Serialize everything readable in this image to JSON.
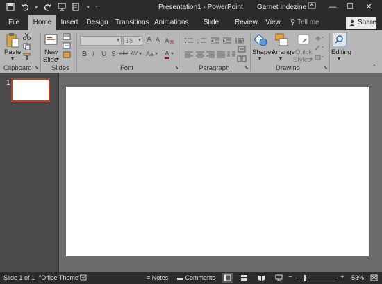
{
  "titlebar": {
    "title": "Presentation1 - PowerPoint",
    "user": "Garnet Indezine",
    "minimize": "—",
    "maximize": "☐",
    "close": "✕"
  },
  "tabs": [
    "File",
    "Home",
    "Insert",
    "Design",
    "Transitions",
    "Animations",
    "Slide Show",
    "Review",
    "View"
  ],
  "tellme": "Tell me",
  "share": "Share",
  "ribbon": {
    "clipboard": {
      "paste": "Paste",
      "label": "Clipboard"
    },
    "slides": {
      "new_slide_1": "New",
      "new_slide_2": "Slide",
      "label": "Slides"
    },
    "font": {
      "font_name": "",
      "font_size": "18",
      "grow": "A",
      "shrink": "A",
      "bold": "B",
      "italic": "I",
      "underline": "U",
      "strike": "S",
      "shadow": "abc",
      "spacing": "AV",
      "case": "Aa",
      "color": "A",
      "label": "Font"
    },
    "paragraph": {
      "label": "Paragraph"
    },
    "drawing": {
      "shapes": "Shapes",
      "arrange": "Arrange",
      "quick_styles_1": "Quick",
      "quick_styles_2": "Styles",
      "label": "Drawing"
    },
    "editing": {
      "label": "Editing"
    }
  },
  "thumbnails": {
    "slide_number": "1"
  },
  "status": {
    "slide_info": "Slide 1 of 1",
    "theme": "\"Office Theme\"",
    "notes": "Notes",
    "comments": "Comments",
    "zoom_minus": "−",
    "zoom_plus": "+",
    "zoom": "53%"
  },
  "colors": {
    "titlebar": "#2b2b2b",
    "ribbon": "#b7b7b7",
    "editor": "#6a6a6a",
    "thumb_border": "#c43e1c"
  }
}
